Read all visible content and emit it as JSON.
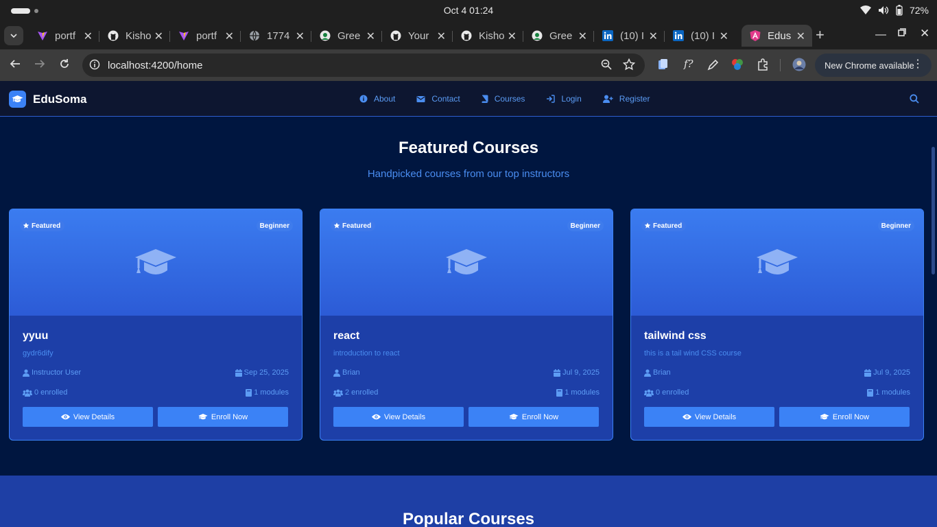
{
  "os": {
    "datetime": "Oct 4  01:24",
    "battery": "72%"
  },
  "tabs": [
    {
      "title": "portf",
      "favicon": "vite"
    },
    {
      "title": "Kisho",
      "favicon": "github"
    },
    {
      "title": "portf",
      "favicon": "vite"
    },
    {
      "title": "1774",
      "favicon": "globe"
    },
    {
      "title": "Gree",
      "favicon": "greenhouse"
    },
    {
      "title": "Your",
      "favicon": "github"
    },
    {
      "title": "Kisho",
      "favicon": "github"
    },
    {
      "title": "Gree",
      "favicon": "greenhouse"
    },
    {
      "title": "(10) I",
      "favicon": "linkedin"
    },
    {
      "title": "(10) I",
      "favicon": "linkedin"
    },
    {
      "title": "Edus",
      "favicon": "angular",
      "active": true
    }
  ],
  "toolbar": {
    "url": "localhost:4200/home",
    "chrome_update": "New Chrome available"
  },
  "app": {
    "brand": "EduSoma",
    "nav": [
      {
        "label": "About",
        "icon": "info-icon"
      },
      {
        "label": "Contact",
        "icon": "envelope-icon"
      },
      {
        "label": "Courses",
        "icon": "book-icon"
      },
      {
        "label": "Login",
        "icon": "sign-in-icon"
      },
      {
        "label": "Register",
        "icon": "user-plus-icon"
      }
    ]
  },
  "featured": {
    "title": "Featured Courses",
    "subtitle": "Handpicked courses from our top instructors",
    "courses": [
      {
        "badge": "Featured",
        "level": "Beginner",
        "title": "yyuu",
        "description": "gydr6dify",
        "instructor": "Instructor User",
        "date": "Sep 25, 2025",
        "enrolled": "0 enrolled",
        "modules": "1 modules",
        "view_label": "View Details",
        "enroll_label": "Enroll Now"
      },
      {
        "badge": "Featured",
        "level": "Beginner",
        "title": "react",
        "description": "introduction to react",
        "instructor": "Brian",
        "date": "Jul 9, 2025",
        "enrolled": "2 enrolled",
        "modules": "1 modules",
        "view_label": "View Details",
        "enroll_label": "Enroll Now"
      },
      {
        "badge": "Featured",
        "level": "Beginner",
        "title": "tailwind css",
        "description": "this is a tail wind CSS course",
        "instructor": "Brian",
        "date": "Jul 9, 2025",
        "enrolled": "0 enrolled",
        "modules": "1 modules",
        "view_label": "View Details",
        "enroll_label": "Enroll Now"
      }
    ]
  },
  "popular": {
    "title": "Popular Courses"
  },
  "colors": {
    "accent": "#3b82f6",
    "page_bg": "#001640",
    "card_bg": "#1d3fa8",
    "nav_bg": "#0d1630"
  }
}
